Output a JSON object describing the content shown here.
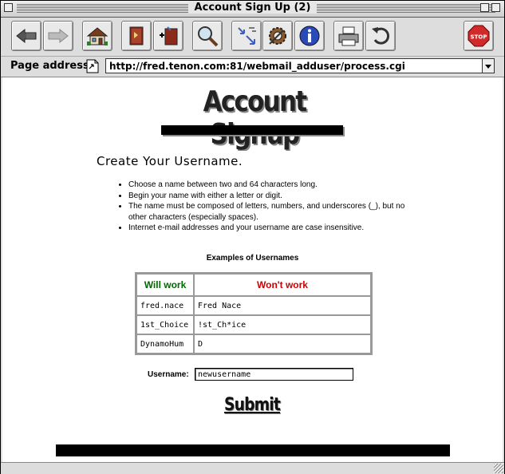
{
  "window": {
    "title": "Account Sign Up (2)"
  },
  "toolbar": {
    "buttons": [
      "back-icon",
      "forward-icon",
      "home-icon",
      "bookmarks-icon",
      "add-bookmark-icon",
      "find-icon",
      "transfer-icon",
      "preferences-icon",
      "info-icon",
      "print-icon",
      "reload-icon",
      "stop-icon"
    ],
    "stop_label": "STOP"
  },
  "address_bar": {
    "label": "Page address:",
    "url": "http://fred.tenon.com:81/webmail_adduser/process.cgi"
  },
  "page": {
    "logo_text": "Account Signup",
    "heading": "Create Your Username.",
    "rules": [
      "Choose a name between two and 64 characters long.",
      "Begin your name with either a letter or digit.",
      "The name must be composed of letters, numbers, and underscores (_), but no other characters (especially spaces).",
      "Internet e-mail addresses and your username are case insensitive."
    ],
    "examples_title": "Examples of Usernames",
    "table": {
      "headers": [
        "Will work",
        "Won't work"
      ],
      "rows": [
        [
          "fred.nace",
          "Fred Nace"
        ],
        [
          "1st_Choice",
          "!st_Ch*ice"
        ],
        [
          "DynamoHum",
          "D"
        ]
      ]
    },
    "form": {
      "username_label": "Username:",
      "username_value": "newusername",
      "submit_label": "Submit"
    }
  },
  "colors": {
    "will_work": "#006600",
    "wont_work": "#cc0000"
  }
}
